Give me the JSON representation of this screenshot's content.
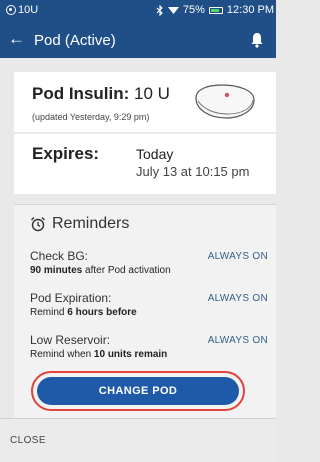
{
  "status_bar": {
    "left_text": "10U",
    "battery_percent": "75%",
    "battery_level": 0.75,
    "time": "12:30 PM",
    "icons": [
      "pod-status-icon",
      "bluetooth-icon",
      "wifi-icon",
      "battery-icon"
    ]
  },
  "app_bar": {
    "title": "Pod (Active)",
    "back_icon": "back-arrow-icon",
    "notification_icon": "bell-icon"
  },
  "insulin": {
    "label": "Pod Insulin:",
    "value": "10 U",
    "updated": "(updated Yesterday, 9:29 pm)"
  },
  "expires": {
    "label": "Expires:",
    "day": "Today",
    "time": "July 13 at 10:15 pm"
  },
  "reminders": {
    "header": "Reminders",
    "items": [
      {
        "title": "Check BG:",
        "status": "ALWAYS ON",
        "desc_bold": "90 minutes",
        "desc_rest": " after Pod activation"
      },
      {
        "title": "Pod Expiration:",
        "status": "ALWAYS ON",
        "desc_pre": "Remind ",
        "desc_bold": "6 hours before"
      },
      {
        "title": "Low Reservoir:",
        "status": "ALWAYS ON",
        "desc_pre": "Remind when ",
        "desc_bold": "10 units remain"
      }
    ]
  },
  "actions": {
    "change_pod": "CHANGE POD",
    "close": "CLOSE"
  },
  "colors": {
    "header_bg": "#1f4f86",
    "button_bg": "#1f5aa8",
    "highlight_ring": "#e0433b"
  }
}
